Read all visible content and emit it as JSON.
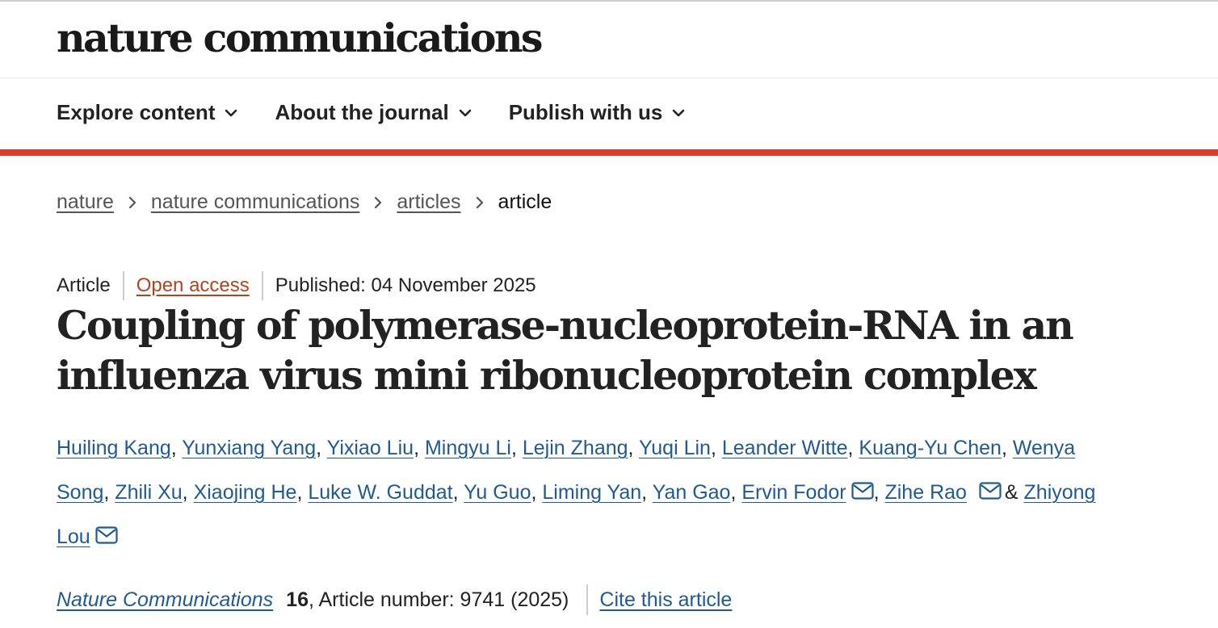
{
  "site": {
    "brand": "nature communications"
  },
  "nav": {
    "items": [
      {
        "label": "Explore content"
      },
      {
        "label": "About the journal"
      },
      {
        "label": "Publish with us"
      }
    ]
  },
  "colors": {
    "accent_bar": "#dd3a2a",
    "link": "#1f5a94",
    "open_access": "#b4431d"
  },
  "breadcrumb": {
    "items": [
      "nature",
      "nature communications",
      "articles"
    ],
    "current": "article"
  },
  "article": {
    "type": "Article",
    "access": "Open access",
    "published": "Published: 04 November 2025",
    "title": "Coupling of polymerase-nucleoprotein-RNA in an influenza virus mini ribonucleoprotein complex",
    "authors": [
      "Huiling Kang",
      "Yunxiang Yang",
      "Yixiao Liu",
      "Mingyu Li",
      "Lejin Zhang",
      "Yuqi Lin",
      "Leander Witte",
      "Kuang-Yu Chen",
      "Wenya Song",
      "Zhili Xu",
      "Xiaojing He",
      "Luke W. Guddat",
      "Yu Guo",
      "Liming Yan",
      "Yan Gao",
      "Ervin Fodor",
      "Zihe Rao",
      "Zhiyong Lou"
    ],
    "author_separator": ",",
    "author_conjunction": "&",
    "citation": {
      "journal": "Nature Communications",
      "volume": "16",
      "rest": ", Article number: 9741 (2025)",
      "cite_label": "Cite this article"
    }
  }
}
